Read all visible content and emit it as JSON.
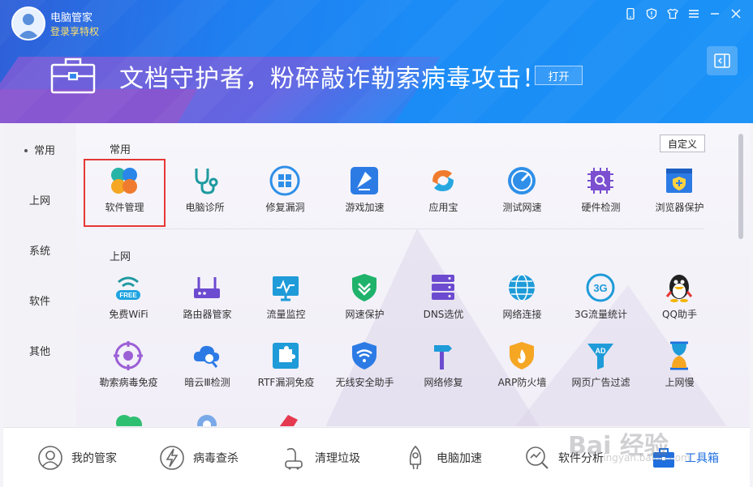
{
  "app": {
    "title": "电脑管家",
    "login_text": "登录享特权"
  },
  "banner": {
    "headline": "文档守护者，粉碎敲诈勒索病毒攻击！",
    "open_label": "打开"
  },
  "nav": {
    "items": [
      {
        "label": "常用",
        "active": true
      },
      {
        "label": "上网"
      },
      {
        "label": "系统"
      },
      {
        "label": "软件"
      },
      {
        "label": "其他"
      }
    ]
  },
  "toolbar": {
    "custom_label": "自定义"
  },
  "sections": {
    "common": {
      "title": "常用",
      "tools": [
        {
          "label": "软件管理",
          "icon": "software-manager-icon",
          "selected": true
        },
        {
          "label": "电脑诊所",
          "icon": "stethoscope-icon"
        },
        {
          "label": "修复漏洞",
          "icon": "windows-repair-icon"
        },
        {
          "label": "游戏加速",
          "icon": "game-boost-icon"
        },
        {
          "label": "应用宝",
          "icon": "app-store-icon"
        },
        {
          "label": "测试网速",
          "icon": "speedometer-icon"
        },
        {
          "label": "硬件检测",
          "icon": "chip-search-icon"
        },
        {
          "label": "浏览器保护",
          "icon": "browser-shield-icon"
        }
      ]
    },
    "internet": {
      "title": "上网",
      "tools": [
        {
          "label": "免费WiFi",
          "icon": "wifi-free-icon"
        },
        {
          "label": "路由器管家",
          "icon": "router-icon"
        },
        {
          "label": "流量监控",
          "icon": "monitor-icon"
        },
        {
          "label": "网速保护",
          "icon": "shield-down-icon"
        },
        {
          "label": "DNS选优",
          "icon": "dns-server-icon"
        },
        {
          "label": "网络连接",
          "icon": "globe-icon"
        },
        {
          "label": "3G流量统计",
          "icon": "3g-icon"
        },
        {
          "label": "QQ助手",
          "icon": "qq-penguin-icon"
        },
        {
          "label": "勒索病毒免疫",
          "icon": "virus-target-icon"
        },
        {
          "label": "暗云Ⅲ检测",
          "icon": "cloud-search-icon"
        },
        {
          "label": "RTF漏洞免疫",
          "icon": "puzzle-icon"
        },
        {
          "label": "无线安全助手",
          "icon": "wifi-shield-icon"
        },
        {
          "label": "网络修复",
          "icon": "hammer-icon"
        },
        {
          "label": "ARP防火墙",
          "icon": "fire-shield-icon"
        },
        {
          "label": "网页广告过滤",
          "icon": "ad-filter-icon"
        },
        {
          "label": "上网慢",
          "icon": "hourglass-icon"
        }
      ]
    }
  },
  "bottom_nav": [
    {
      "label": "我的管家",
      "icon": "user-icon"
    },
    {
      "label": "病毒查杀",
      "icon": "lightning-icon"
    },
    {
      "label": "清理垃圾",
      "icon": "vacuum-icon"
    },
    {
      "label": "电脑加速",
      "icon": "rocket-icon"
    },
    {
      "label": "软件分析",
      "icon": "magnifier-chart-icon"
    },
    {
      "label": "工具箱",
      "icon": "toolbox-icon",
      "active": true
    }
  ],
  "watermark": {
    "text": "Bai 经验",
    "sub": "jingyan.baidu.com"
  },
  "colors": {
    "header_blue": "#1b8cf6",
    "accent_blue": "#1e6fe0",
    "selection_red": "#e53935"
  }
}
